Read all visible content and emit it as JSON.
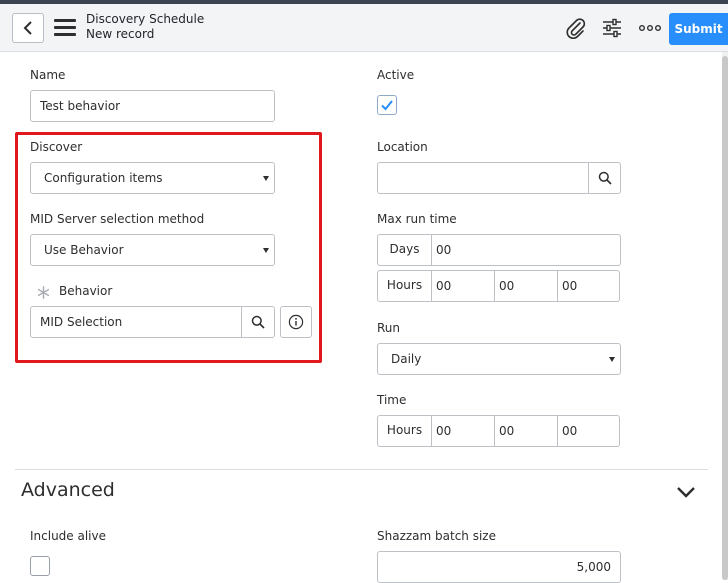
{
  "header": {
    "title": "Discovery Schedule",
    "subtitle": "New record",
    "submit_label": "Submit"
  },
  "form": {
    "name": {
      "label": "Name",
      "value": "Test behavior"
    },
    "active": {
      "label": "Active",
      "checked": true
    },
    "discover": {
      "label": "Discover",
      "value": "Configuration items"
    },
    "location": {
      "label": "Location",
      "value": ""
    },
    "mid_method": {
      "label": "MID Server selection method",
      "value": "Use Behavior"
    },
    "max_run_time": {
      "label": "Max run time",
      "days_label": "Days",
      "days_value": "00",
      "hours_label": "Hours",
      "hours_value": "00",
      "minutes_value": "00",
      "seconds_value": "00"
    },
    "behavior": {
      "label": "Behavior",
      "value": "MID Selection"
    },
    "run": {
      "label": "Run",
      "value": "Daily"
    },
    "time": {
      "label": "Time",
      "hours_label": "Hours",
      "hours_value": "00",
      "minutes_value": "00",
      "seconds_value": "00"
    }
  },
  "advanced": {
    "title": "Advanced",
    "include_alive": {
      "label": "Include alive",
      "checked": false
    },
    "shazzam_batch_size": {
      "label": "Shazzam batch size",
      "value": "5,000"
    }
  }
}
